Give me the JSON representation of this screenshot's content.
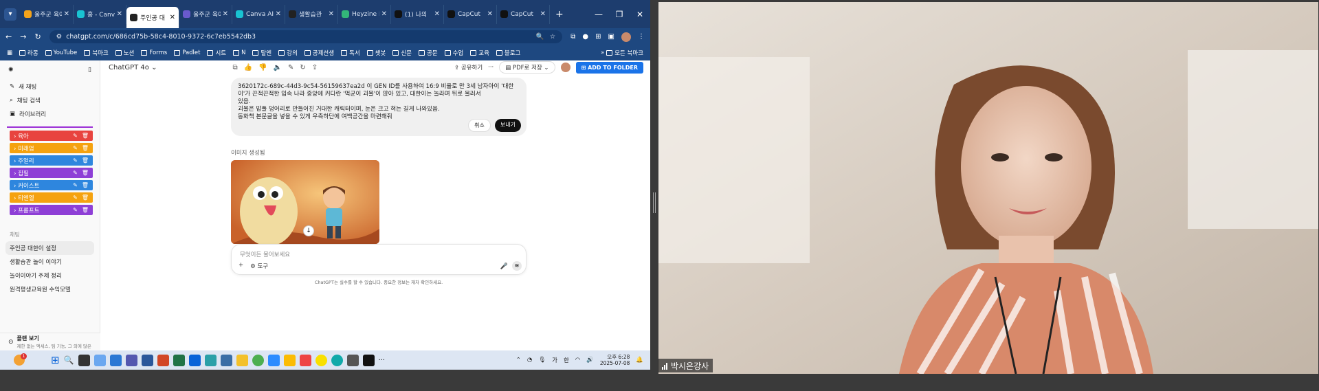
{
  "browser": {
    "tabs": [
      {
        "title": "울주군 육아",
        "color": "#f4a31a",
        "active": false
      },
      {
        "title": "홈 - Canva",
        "color": "#19c3d2",
        "active": false
      },
      {
        "title": "주인공 대",
        "color": "#222222",
        "active": true
      },
      {
        "title": "울주군 육아",
        "color": "#6a5acd",
        "active": false
      },
      {
        "title": "Canva AI",
        "color": "#19c3d2",
        "active": false
      },
      {
        "title": "생활습관",
        "color": "#222222",
        "active": false
      },
      {
        "title": "Heyzine Fl",
        "color": "#33b679",
        "active": false
      },
      {
        "title": "(1) 나의",
        "color": "#111111",
        "active": false
      },
      {
        "title": "CapCut",
        "color": "#111111",
        "active": false
      },
      {
        "title": "CapCut",
        "color": "#111111",
        "active": false
      }
    ],
    "new_tab": "+",
    "url": "chatgpt.com/c/686cd75b-58c4-8010-9372-6c7eb5542db3",
    "bookmarks": [
      "라몽",
      "YouTube",
      "북마크",
      "노션",
      "Forms",
      "Padlet",
      "시트",
      "N",
      "탈엔",
      "강의",
      "공제선생",
      "독서",
      "챗봇",
      "신문",
      "공문",
      "수업",
      "교육",
      "블로그"
    ],
    "all_bookmarks": "모든 북마크"
  },
  "sidebar": {
    "nav": [
      {
        "label": "새 채팅",
        "icon": "edit-icon"
      },
      {
        "label": "채팅 검색",
        "icon": "search-icon"
      },
      {
        "label": "라이브러리",
        "icon": "library-icon"
      }
    ],
    "folders": [
      {
        "label": "육아",
        "color": "#e8443f"
      },
      {
        "label": "미래엄",
        "color": "#f5a20f"
      },
      {
        "label": "주얼리",
        "color": "#2e86de"
      },
      {
        "label": "집필",
        "color": "#8e3fd6"
      },
      {
        "label": "커이스트",
        "color": "#2e86de"
      },
      {
        "label": "티엔엘",
        "color": "#f5a20f"
      },
      {
        "label": "프롬프트",
        "color": "#8e3fd6"
      }
    ],
    "section_label": "채팅",
    "chats": [
      "주인공 대한이 설정",
      "생활습관 놀이 이야기",
      "놀이이야기 주제 정리",
      "원격평생교육원 수익모델"
    ],
    "plan_title": "플랜 보기",
    "plan_sub": "제한 없는 액세스, 팀 기능, 그 외에 많은"
  },
  "main": {
    "model": "ChatGPT 4o",
    "share": "공유하기",
    "pdf": "PDF로 저장",
    "add_folder": "ADD TO FOLDER",
    "edit_text": {
      "line1": "3620172c-689c-44d3-9c54-56159637ea2d 이 GEN ID를 사용하여 16:9 비율로 만 3세 남자아이 '대한",
      "line2": "이'가 끈적끈적한 입속 나라 중앙에 커다란 '먹균이 괴물'이 앉아 있고, 대한이는 놀라며 뒤로 물러서",
      "line3": "있음.",
      "line4": "괴물은 밥풀 덩어리로 만들어진 거대한 캐릭터이며, 눈은 크고 혀는 길게 나와있음.",
      "line5": "동화책 본문글을 넣을 수 있게 우측하단에 여백공간을 마련해줘"
    },
    "cancel": "취소",
    "send": "보내기",
    "generated_label": "이미지 생성됨",
    "composer_placeholder": "무엇이든 물어보세요",
    "tools_label": "도구",
    "disclaimer": "ChatGPT는 실수를 할 수 있습니다. 중요한 정보는 재차 확인하세요."
  },
  "taskbar": {
    "badge": "1",
    "ime": "가",
    "lang": "한",
    "time": "오후 6:28",
    "date": "2025-07-08"
  },
  "video": {
    "name": "박시은강사"
  }
}
